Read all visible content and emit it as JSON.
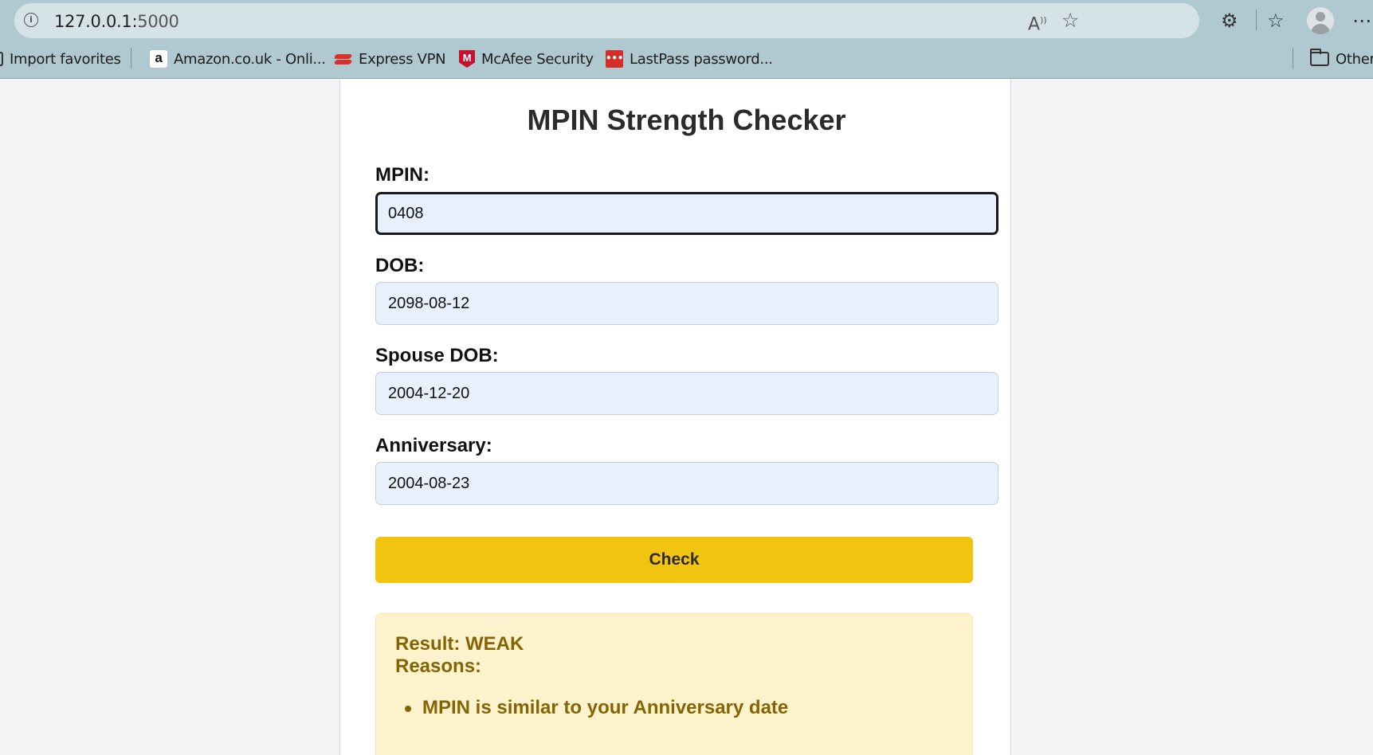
{
  "browser": {
    "url_host": "127.0.0.1:",
    "url_port": "5000",
    "read_aloud_icon": "read-aloud-icon",
    "favorite_icon": "star-icon",
    "bookmarks": [
      {
        "label": "Import favorites",
        "icon": "import-icon"
      },
      {
        "label": "Amazon.co.uk - Onli...",
        "icon": "amazon-icon",
        "icon_text": "a"
      },
      {
        "label": "Express VPN",
        "icon": "expressvpn-icon"
      },
      {
        "label": "McAfee Security",
        "icon": "mcafee-icon",
        "icon_text": "M"
      },
      {
        "label": "LastPass password...",
        "icon": "lastpass-icon",
        "icon_text": "•••"
      },
      {
        "label": "Other",
        "icon": "folder-icon"
      }
    ]
  },
  "page": {
    "title": "MPIN Strength Checker",
    "fields": [
      {
        "label": "MPIN:",
        "value": "0408"
      },
      {
        "label": "DOB:",
        "value": "2098-08-12"
      },
      {
        "label": "Spouse DOB:",
        "value": "2004-12-20"
      },
      {
        "label": "Anniversary:",
        "value": "2004-08-23"
      }
    ],
    "check_label": "Check",
    "result": {
      "result_line": "Result: WEAK",
      "reasons_heading": "Reasons:",
      "reasons": [
        "MPIN is similar to your Anniversary date"
      ]
    }
  },
  "colors": {
    "button": "#f1c40f",
    "result_bg": "#fef3cd",
    "result_text": "#856404",
    "field_bg": "#e8f0fe"
  }
}
